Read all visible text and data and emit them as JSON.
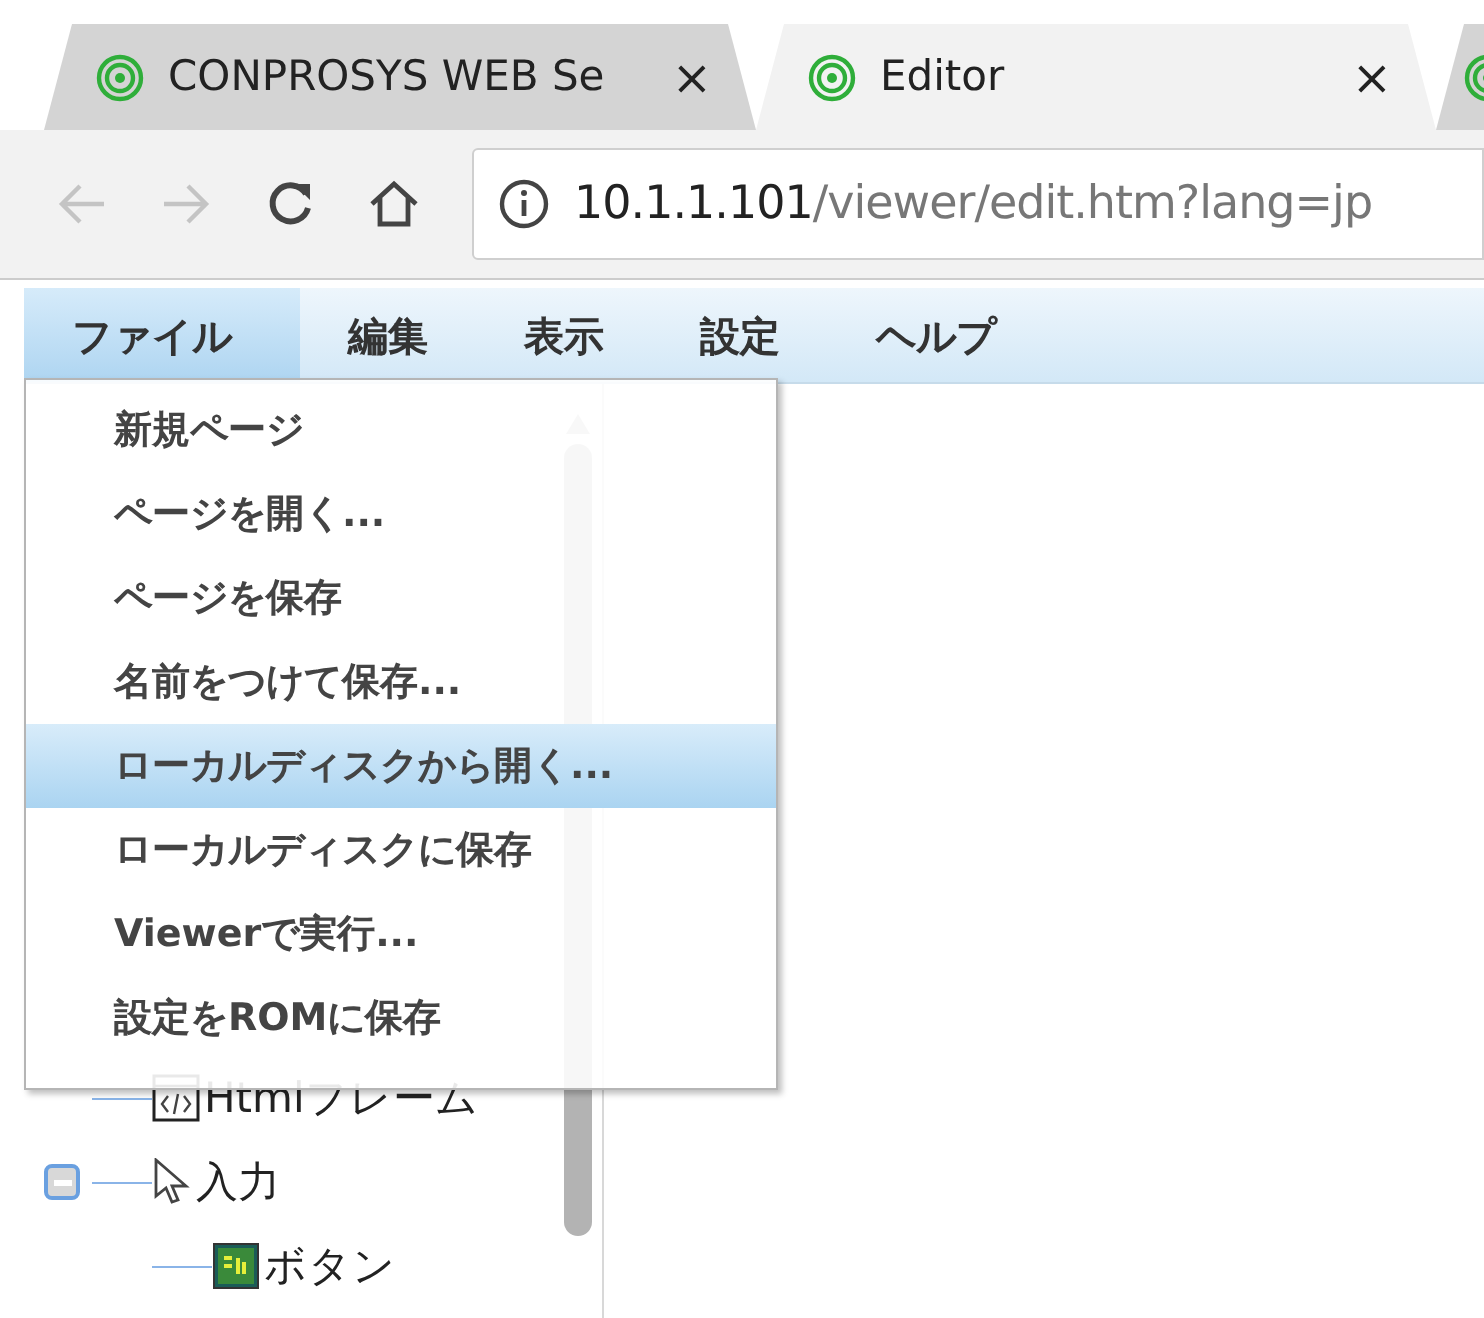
{
  "browser": {
    "tabs": [
      {
        "title": "CONPROSYS WEB Se",
        "selected": false,
        "close": "×"
      },
      {
        "title": "Editor",
        "selected": true,
        "close": "×"
      },
      {
        "selected": false
      }
    ],
    "address": {
      "host": "10.1.1.101",
      "path": "/viewer/edit.htm?lang=jp"
    }
  },
  "menubar": [
    {
      "label": "ファイル",
      "selected": true
    },
    {
      "label": "編集",
      "selected": false
    },
    {
      "label": "表示",
      "selected": false
    },
    {
      "label": "設定",
      "selected": false
    },
    {
      "label": "ヘルプ",
      "selected": false
    }
  ],
  "file_menu": [
    {
      "label": "新規ページ",
      "selected": false
    },
    {
      "label": "ページを開く...",
      "selected": false
    },
    {
      "label": "ページを保存",
      "selected": false
    },
    {
      "label": "名前をつけて保存...",
      "selected": false
    },
    {
      "label": "ローカルディスクから開く...",
      "selected": true
    },
    {
      "label": "ローカルディスクに保存",
      "selected": false
    },
    {
      "label": "Viewerで実行...",
      "selected": false
    },
    {
      "label": "設定をROMに保存",
      "selected": false
    }
  ],
  "tree": [
    {
      "label": "Htmlフレーム",
      "kind": "frame"
    },
    {
      "label": "入力",
      "kind": "input",
      "expanded": true,
      "children": [
        {
          "label": "ボタン",
          "kind": "button"
        }
      ]
    }
  ]
}
